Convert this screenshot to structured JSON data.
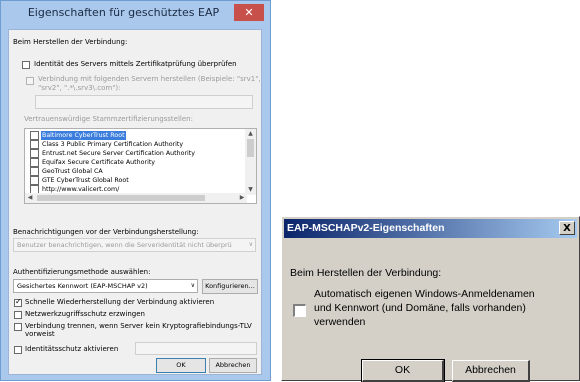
{
  "left_dialog": {
    "title": "Eigenschaften für geschütztes EAP",
    "close_glyph": "✕",
    "connect_heading": "Beim Herstellen der Verbindung:",
    "verify_server_label": "Identität des Servers mittels Zertifikatprüfung überprüfen",
    "connect_servers_line1": "Verbindung mit folgenden Servern herstellen (Beispiele: \"srv1\",",
    "connect_servers_line2": "\"srv2\", \".*\\.srv3\\.com\"):",
    "trusted_roots_label": "Vertrauenswürdige Stammzertifizierungsstellen:",
    "trusted_roots": [
      {
        "label": "Baltimore CyberTrust Root",
        "selected": true
      },
      {
        "label": "Class 3 Public Primary Certification Authority",
        "selected": false
      },
      {
        "label": "Entrust.net Secure Server Certification Authority",
        "selected": false
      },
      {
        "label": "Equifax Secure Certificate Authority",
        "selected": false
      },
      {
        "label": "GeoTrust Global CA",
        "selected": false
      },
      {
        "label": "GTE CyberTrust Global Root",
        "selected": false
      },
      {
        "label": "http://www.valicert.com/",
        "selected": false
      }
    ],
    "notify_label": "Benachrichtigungen vor der Verbindungsherstellung:",
    "notify_value": "Benutzer benachrichtigen, wenn die Serveridentität nicht überprü",
    "auth_method_label": "Authentifizierungsmethode auswählen:",
    "auth_method_value": "Gesichertes Kennwort (EAP-MSCHAP v2)",
    "configure_button": "Konfigurieren...",
    "fast_reconnect_label": "Schnelle Wiederherstellung der Verbindung aktivieren",
    "nap_label": "Netzwerkzugriffsschutz erzwingen",
    "disconnect_line1": "Verbindung trennen, wenn Server kein Kryptografiebindungs-TLV",
    "disconnect_line2": "vorweist",
    "identity_privacy_label": "Identitätsschutz aktivieren",
    "ok_button": "OK",
    "cancel_button": "Abbrechen",
    "fast_reconnect_checked": true
  },
  "right_dialog": {
    "title": "EAP-MSCHAPv2-Eigenschaften",
    "close_glyph": "X",
    "connect_heading": "Beim Herstellen der Verbindung:",
    "auto_logon_line1": "Automatisch eigenen Windows-Anmeldenamen",
    "auto_logon_line2": "und Kennwort (und Domäne, falls vorhanden)",
    "auto_logon_line3": "verwenden",
    "ok_button": "OK",
    "cancel_button": "Abbrechen",
    "auto_logon_checked": false
  }
}
